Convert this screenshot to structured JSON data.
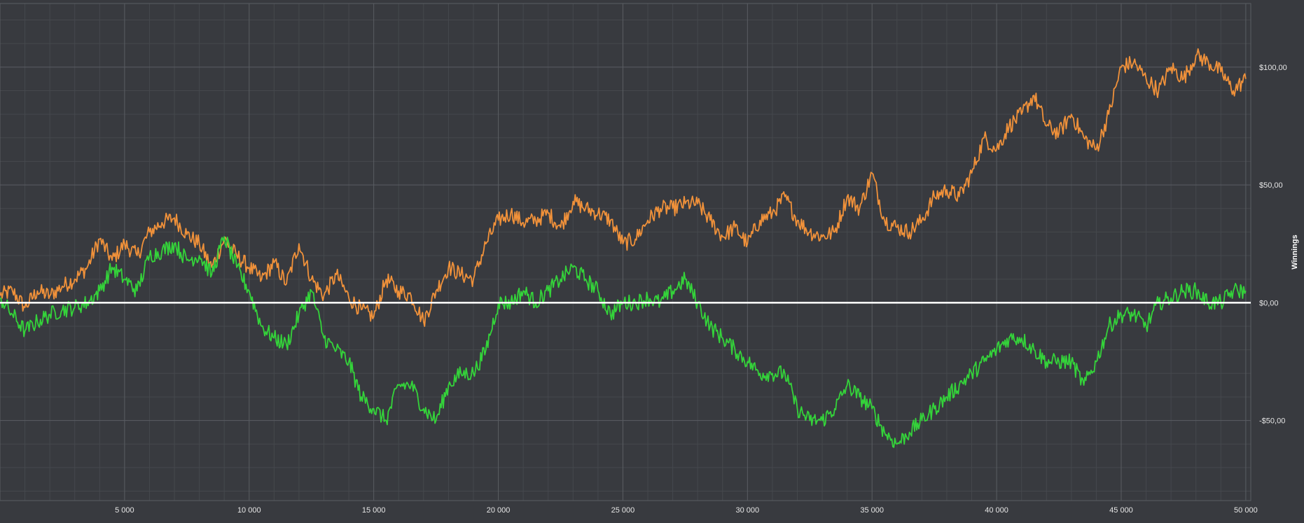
{
  "chart_data": {
    "type": "line",
    "title": "",
    "ylabel": "Winnings",
    "xlabel": "",
    "xlim": [
      0,
      50200
    ],
    "ylim": [
      -84,
      127
    ],
    "x_ticks": [
      5000,
      10000,
      15000,
      20000,
      25000,
      30000,
      35000,
      40000,
      45000,
      50000
    ],
    "x_tick_labels": [
      "5 000",
      "10 000",
      "15 000",
      "20 000",
      "25 000",
      "30 000",
      "35 000",
      "40 000",
      "45 000",
      "50 000"
    ],
    "y_ticks": [
      100,
      50,
      0,
      -50
    ],
    "y_tick_labels": [
      "$100,00",
      "$50,00",
      "$0,00",
      "-$50,00"
    ],
    "grid": true,
    "colors": {
      "background": "#383a3f",
      "grid_major": "#5a5d63",
      "grid_minor": "#45484d",
      "zero_line": "#ffffff",
      "series_orange": "#f0913a",
      "series_green": "#34d33a"
    },
    "series": [
      {
        "color": "#f0913a",
        "x": [
          0,
          500,
          1000,
          1500,
          2000,
          2500,
          3000,
          3500,
          4000,
          4500,
          5000,
          5500,
          6000,
          6500,
          7000,
          7500,
          8000,
          8500,
          9000,
          9500,
          10000,
          10500,
          11000,
          11500,
          12000,
          12500,
          13000,
          13500,
          14000,
          14500,
          15000,
          15500,
          16000,
          16500,
          17000,
          17500,
          18000,
          18500,
          19000,
          19500,
          20000,
          20500,
          21000,
          21500,
          22000,
          22500,
          23000,
          23500,
          24000,
          24500,
          25000,
          25500,
          26000,
          26500,
          27000,
          27500,
          28000,
          28500,
          29000,
          29500,
          30000,
          30500,
          31000,
          31500,
          32000,
          32500,
          33000,
          33500,
          34000,
          34500,
          35000,
          35500,
          36000,
          36500,
          37000,
          37500,
          38000,
          38500,
          39000,
          39500,
          40000,
          40500,
          41000,
          41500,
          42000,
          42500,
          43000,
          43500,
          44000,
          44500,
          45000,
          45500,
          46000,
          46500,
          47000,
          47500,
          48000,
          48500,
          49000,
          49500,
          50000
        ],
        "values": [
          3,
          5,
          -2,
          5,
          3,
          7,
          10,
          15,
          27,
          18,
          25,
          20,
          30,
          34,
          36,
          29,
          25,
          15,
          27,
          20,
          15,
          10,
          17,
          8,
          25,
          10,
          3,
          12,
          2,
          -3,
          -6,
          10,
          5,
          3,
          -8,
          5,
          15,
          12,
          10,
          25,
          35,
          38,
          34,
          35,
          38,
          32,
          43,
          40,
          38,
          35,
          25,
          27,
          35,
          40,
          40,
          42,
          42,
          35,
          28,
          32,
          25,
          35,
          38,
          45,
          35,
          30,
          28,
          30,
          45,
          40,
          55,
          35,
          32,
          30,
          35,
          45,
          48,
          45,
          55,
          70,
          65,
          75,
          80,
          88,
          75,
          72,
          80,
          70,
          65,
          80,
          100,
          102,
          95,
          90,
          100,
          95,
          105,
          102,
          98,
          90,
          95
        ]
      },
      {
        "color": "#34d33a",
        "x": [
          0,
          500,
          1000,
          1500,
          2000,
          2500,
          3000,
          3500,
          4000,
          4500,
          5000,
          5500,
          6000,
          6500,
          7000,
          7500,
          8000,
          8500,
          9000,
          9500,
          10000,
          10500,
          11000,
          11500,
          12000,
          12500,
          13000,
          13500,
          14000,
          14500,
          15000,
          15500,
          16000,
          16500,
          17000,
          17500,
          18000,
          18500,
          19000,
          19500,
          20000,
          20500,
          21000,
          21500,
          22000,
          22500,
          23000,
          23500,
          24000,
          24500,
          25000,
          25500,
          26000,
          26500,
          27000,
          27500,
          28000,
          28500,
          29000,
          29500,
          30000,
          30500,
          31000,
          31500,
          32000,
          32500,
          33000,
          33500,
          34000,
          34500,
          35000,
          35500,
          36000,
          36500,
          37000,
          37500,
          38000,
          38500,
          39000,
          39500,
          40000,
          40500,
          41000,
          41500,
          42000,
          42500,
          43000,
          43500,
          44000,
          44500,
          45000,
          45500,
          46000,
          46500,
          47000,
          47500,
          48000,
          48500,
          49000,
          49500,
          50000
        ],
        "values": [
          2,
          -5,
          -12,
          -8,
          -5,
          -3,
          -2,
          0,
          5,
          15,
          10,
          5,
          20,
          22,
          25,
          18,
          20,
          12,
          28,
          15,
          5,
          -10,
          -15,
          -18,
          -5,
          5,
          -15,
          -20,
          -25,
          -40,
          -45,
          -50,
          -35,
          -35,
          -45,
          -50,
          -35,
          -30,
          -30,
          -20,
          0,
          0,
          5,
          0,
          5,
          10,
          15,
          10,
          5,
          -5,
          0,
          0,
          2,
          0,
          5,
          10,
          0,
          -10,
          -15,
          -20,
          -25,
          -30,
          -30,
          -30,
          -45,
          -50,
          -50,
          -45,
          -35,
          -40,
          -45,
          -55,
          -60,
          -55,
          -50,
          -45,
          -40,
          -35,
          -30,
          -25,
          -20,
          -15,
          -15,
          -20,
          -25,
          -25,
          -25,
          -35,
          -25,
          -10,
          -5,
          -5,
          -10,
          0,
          2,
          5,
          5,
          0,
          0,
          5,
          5
        ]
      }
    ]
  }
}
